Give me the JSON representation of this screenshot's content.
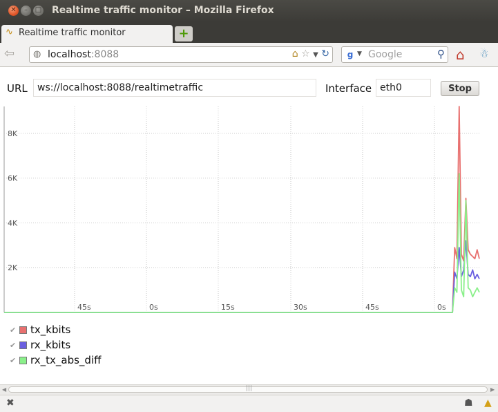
{
  "window": {
    "title": "Realtime traffic monitor – Mozilla Firefox"
  },
  "tab": {
    "label": "Realtime traffic monitor",
    "new_tab_symbol": "+"
  },
  "navbar": {
    "url_host": "localhost",
    "url_port": ":8088",
    "search_placeholder": "Google"
  },
  "form": {
    "url_label": "URL",
    "url_value": "ws://localhost:8088/realtimetraffic",
    "interface_label": "Interface",
    "interface_value": "eth0",
    "stop_label": "Stop"
  },
  "chart_data": {
    "type": "line",
    "y_ticks": [
      "2K",
      "4K",
      "6K",
      "8K"
    ],
    "x_ticks": [
      "45s",
      "0s",
      "15s",
      "30s",
      "45s",
      "0s"
    ],
    "ylim": [
      0,
      9200
    ],
    "grid": true,
    "legend_position": "bottom-left",
    "series": [
      {
        "name": "tx_kbits",
        "color": "#e8706f",
        "values": [
          0,
          0,
          0,
          0,
          0,
          0,
          0,
          0,
          0,
          0,
          0,
          0,
          0,
          0,
          0,
          0,
          0,
          0,
          0,
          0,
          0,
          0,
          0,
          0,
          0,
          0,
          0,
          0,
          0,
          0,
          0,
          0,
          0,
          0,
          0,
          0,
          0,
          0,
          0,
          0,
          0,
          0,
          0,
          0,
          0,
          0,
          0,
          0,
          0,
          0,
          0,
          0,
          0,
          0,
          0,
          0,
          0,
          0,
          0,
          0,
          0,
          0,
          0,
          0,
          0,
          0,
          0,
          0,
          0,
          0,
          0,
          0,
          0,
          0,
          0,
          0,
          0,
          0,
          0,
          0,
          0,
          0,
          0,
          0,
          0,
          0,
          0,
          0,
          0,
          0,
          0,
          0,
          0,
          0,
          0,
          0,
          0,
          0,
          0,
          0,
          0,
          0,
          0,
          0,
          0,
          0,
          0,
          0,
          0,
          0,
          0,
          0,
          0,
          0,
          0,
          0,
          0,
          0,
          0,
          0,
          0,
          0,
          0,
          0,
          0,
          0,
          0,
          0,
          0,
          0,
          0,
          0,
          0,
          0,
          0,
          0,
          0,
          0,
          0,
          0,
          0,
          0,
          0,
          0,
          0,
          0,
          0,
          0,
          0,
          0,
          0,
          0,
          0,
          0,
          0,
          0,
          0,
          0,
          0,
          0,
          0,
          0,
          0,
          0,
          0,
          0,
          0,
          0,
          0,
          0,
          0,
          0,
          0,
          0,
          0,
          0,
          0,
          0,
          0,
          0,
          0,
          0,
          0,
          0,
          0,
          0,
          0,
          0,
          0,
          0,
          0,
          0,
          0,
          0,
          0,
          0,
          0,
          0,
          0,
          0,
          0,
          2900,
          2400,
          9200,
          2600,
          2300,
          5100,
          2800,
          2600,
          2500,
          2400,
          2800,
          2400
        ]
      },
      {
        "name": "rx_kbits",
        "color": "#6a5fe0",
        "values": [
          0,
          0,
          0,
          0,
          0,
          0,
          0,
          0,
          0,
          0,
          0,
          0,
          0,
          0,
          0,
          0,
          0,
          0,
          0,
          0,
          0,
          0,
          0,
          0,
          0,
          0,
          0,
          0,
          0,
          0,
          0,
          0,
          0,
          0,
          0,
          0,
          0,
          0,
          0,
          0,
          0,
          0,
          0,
          0,
          0,
          0,
          0,
          0,
          0,
          0,
          0,
          0,
          0,
          0,
          0,
          0,
          0,
          0,
          0,
          0,
          0,
          0,
          0,
          0,
          0,
          0,
          0,
          0,
          0,
          0,
          0,
          0,
          0,
          0,
          0,
          0,
          0,
          0,
          0,
          0,
          0,
          0,
          0,
          0,
          0,
          0,
          0,
          0,
          0,
          0,
          0,
          0,
          0,
          0,
          0,
          0,
          0,
          0,
          0,
          0,
          0,
          0,
          0,
          0,
          0,
          0,
          0,
          0,
          0,
          0,
          0,
          0,
          0,
          0,
          0,
          0,
          0,
          0,
          0,
          0,
          0,
          0,
          0,
          0,
          0,
          0,
          0,
          0,
          0,
          0,
          0,
          0,
          0,
          0,
          0,
          0,
          0,
          0,
          0,
          0,
          0,
          0,
          0,
          0,
          0,
          0,
          0,
          0,
          0,
          0,
          0,
          0,
          0,
          0,
          0,
          0,
          0,
          0,
          0,
          0,
          0,
          0,
          0,
          0,
          0,
          0,
          0,
          0,
          0,
          0,
          0,
          0,
          0,
          0,
          0,
          0,
          0,
          0,
          0,
          0,
          0,
          0,
          0,
          0,
          0,
          0,
          0,
          0,
          0,
          0,
          0,
          0,
          0,
          0,
          0,
          0,
          0,
          0,
          0,
          0,
          0,
          1800,
          1500,
          2900,
          1600,
          1900,
          3200,
          1700,
          1600,
          1900,
          1500,
          1700,
          1500
        ]
      },
      {
        "name": "rx_tx_abs_diff",
        "color": "#8af08a",
        "values": [
          0,
          0,
          0,
          0,
          0,
          0,
          0,
          0,
          0,
          0,
          0,
          0,
          0,
          0,
          0,
          0,
          0,
          0,
          0,
          0,
          0,
          0,
          0,
          0,
          0,
          0,
          0,
          0,
          0,
          0,
          0,
          0,
          0,
          0,
          0,
          0,
          0,
          0,
          0,
          0,
          0,
          0,
          0,
          0,
          0,
          0,
          0,
          0,
          0,
          0,
          0,
          0,
          0,
          0,
          0,
          0,
          0,
          0,
          0,
          0,
          0,
          0,
          0,
          0,
          0,
          0,
          0,
          0,
          0,
          0,
          0,
          0,
          0,
          0,
          0,
          0,
          0,
          0,
          0,
          0,
          0,
          0,
          0,
          0,
          0,
          0,
          0,
          0,
          0,
          0,
          0,
          0,
          0,
          0,
          0,
          0,
          0,
          0,
          0,
          0,
          0,
          0,
          0,
          0,
          0,
          0,
          0,
          0,
          0,
          0,
          0,
          0,
          0,
          0,
          0,
          0,
          0,
          0,
          0,
          0,
          0,
          0,
          0,
          0,
          0,
          0,
          0,
          0,
          0,
          0,
          0,
          0,
          0,
          0,
          0,
          0,
          0,
          0,
          0,
          0,
          0,
          0,
          0,
          0,
          0,
          0,
          0,
          0,
          0,
          0,
          0,
          0,
          0,
          0,
          0,
          0,
          0,
          0,
          0,
          0,
          0,
          0,
          0,
          0,
          0,
          0,
          0,
          0,
          0,
          0,
          0,
          0,
          0,
          0,
          0,
          0,
          0,
          0,
          0,
          0,
          0,
          0,
          0,
          0,
          0,
          0,
          0,
          0,
          0,
          0,
          0,
          0,
          0,
          0,
          0,
          0,
          0,
          0,
          0,
          0,
          0,
          1100,
          900,
          6200,
          1000,
          700,
          5000,
          1100,
          1000,
          700,
          900,
          1100,
          900
        ]
      }
    ]
  },
  "icons": {
    "close_window": "close-icon",
    "back": "back-arrow-icon",
    "home": "home-icon",
    "search": "magnifier-icon"
  }
}
